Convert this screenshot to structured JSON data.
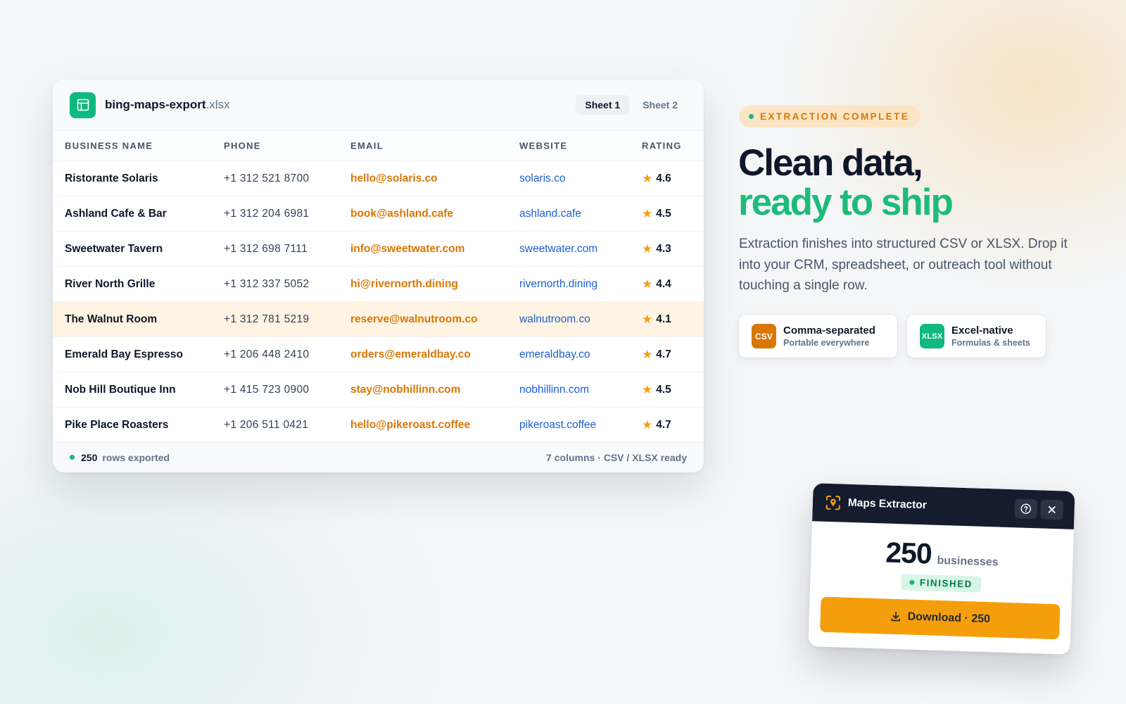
{
  "sheet": {
    "file_base": "bing-maps-export",
    "file_ext": ".xlsx",
    "tabs": [
      {
        "label": "Sheet 1",
        "active": true
      },
      {
        "label": "Sheet 2",
        "active": false
      }
    ],
    "columns": {
      "name": "BUSINESS NAME",
      "phone": "PHONE",
      "email": "EMAIL",
      "website": "WEBSITE",
      "rating": "RATING"
    },
    "rows": [
      {
        "name": "Ristorante Solaris",
        "phone": "+1 312 521 8700",
        "email": "hello@solaris.co",
        "website": "solaris.co",
        "rating": "4.6"
      },
      {
        "name": "Ashland Cafe & Bar",
        "phone": "+1 312 204 6981",
        "email": "book@ashland.cafe",
        "website": "ashland.cafe",
        "rating": "4.5"
      },
      {
        "name": "Sweetwater Tavern",
        "phone": "+1 312 698 7111",
        "email": "info@sweetwater.com",
        "website": "sweetwater.com",
        "rating": "4.3"
      },
      {
        "name": "River North Grille",
        "phone": "+1 312 337 5052",
        "email": "hi@rivernorth.dining",
        "website": "rivernorth.dining",
        "rating": "4.4"
      },
      {
        "name": "The Walnut Room",
        "phone": "+1 312 781 5219",
        "email": "reserve@walnutroom.co",
        "website": "walnutroom.co",
        "rating": "4.1"
      },
      {
        "name": "Emerald Bay Espresso",
        "phone": "+1 206 448 2410",
        "email": "orders@emeraldbay.co",
        "website": "emeraldbay.co",
        "rating": "4.7"
      },
      {
        "name": "Nob Hill Boutique Inn",
        "phone": "+1 415 723 0900",
        "email": "stay@nobhillinn.com",
        "website": "nobhillinn.com",
        "rating": "4.5"
      },
      {
        "name": "Pike Place Roasters",
        "phone": "+1 206 511 0421",
        "email": "hello@pikeroast.coffee",
        "website": "pikeroast.coffee",
        "rating": "4.7"
      }
    ],
    "highlighted_row": 4,
    "footer": {
      "count": "250",
      "count_label": "rows exported",
      "right": "7 columns · CSV / XLSX ready"
    }
  },
  "hero": {
    "badge": "EXTRACTION COMPLETE",
    "headline_1": "Clean data,",
    "headline_2": "ready to ship",
    "lede": "Extraction finishes into structured CSV or XLSX. Drop it into your CRM, spreadsheet, or outreach tool without touching a single row.",
    "formats": [
      {
        "icon": "CSV",
        "title": "Comma-separated",
        "sub": "Portable everywhere"
      },
      {
        "icon": "XLSX",
        "title": "Excel-native",
        "sub": "Formulas & sheets"
      }
    ]
  },
  "popup": {
    "title": "Maps Extractor",
    "count": "250",
    "unit": "businesses",
    "status": "FINISHED",
    "download_label": "Download · 250"
  },
  "colors": {
    "accent_green": "#10b981",
    "accent_orange": "#f59e0b",
    "email_orange": "#d97706",
    "link_blue": "#1d5fd1",
    "navy": "#141c2e"
  }
}
